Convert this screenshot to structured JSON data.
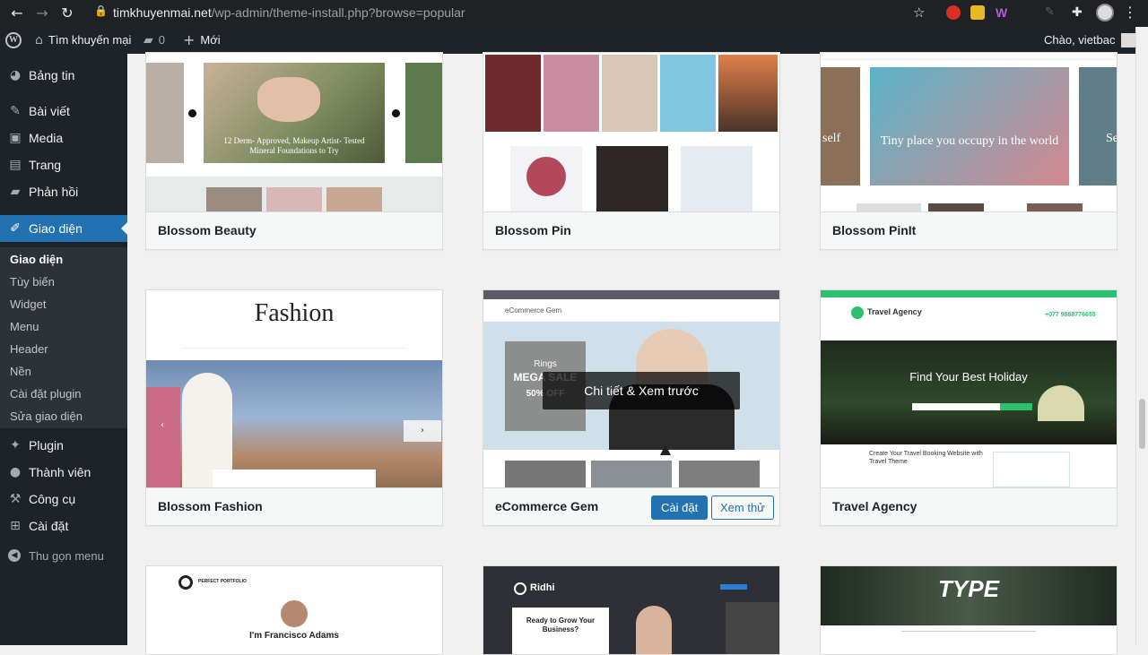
{
  "browser": {
    "url_host": "timkhuyenmai.net",
    "url_path": "/wp-admin/theme-install.php?browse=popular"
  },
  "adminbar": {
    "site_name": "Tìm khuyến mại",
    "comments_count": "0",
    "new_label": "Mới",
    "greeting": "Chào, vietbac"
  },
  "sidebar": {
    "items": [
      {
        "label": "Bảng tin",
        "icon": "dashboard-icon"
      },
      {
        "label": "Bài viết",
        "icon": "pin-icon"
      },
      {
        "label": "Media",
        "icon": "media-icon"
      },
      {
        "label": "Trang",
        "icon": "page-icon"
      },
      {
        "label": "Phản hồi",
        "icon": "comment-icon"
      },
      {
        "label": "Giao diện",
        "icon": "brush-icon"
      },
      {
        "label": "Plugin",
        "icon": "plugin-icon"
      },
      {
        "label": "Thành viên",
        "icon": "users-icon"
      },
      {
        "label": "Công cụ",
        "icon": "tools-icon"
      },
      {
        "label": "Cài đặt",
        "icon": "settings-icon"
      }
    ],
    "submenu": [
      "Giao diện",
      "Tùy biến",
      "Widget",
      "Menu",
      "Header",
      "Nền",
      "Cài đặt plugin",
      "Sửa giao diện"
    ],
    "collapse_label": "Thu gọn menu"
  },
  "themes": {
    "row1": [
      "Blossom Beauty",
      "Blossom Pin",
      "Blossom PinIt"
    ],
    "row2": [
      "Blossom Fashion",
      "eCommerce Gem",
      "Travel Agency"
    ],
    "install_label": "Cài đặt",
    "preview_label": "Xem thử",
    "overlay_label": "Chi tiết & Xem trước"
  },
  "previews": {
    "beauty_caption": "12 Derm- Approved, Makeup Artist- Tested Mineral Foundations to Try",
    "pinit_caption": "Tiny place you occupy in the world",
    "pinit_left": "self",
    "pinit_right": "Se",
    "fashion_title": "Fashion",
    "gem_brand": "eCommerce Gem",
    "gem_rings": "Rings",
    "gem_mega": "MEGA SALE",
    "gem_off": "50% OFF",
    "travel_brand": "Travel Agency",
    "travel_phone": "+077 9888776655",
    "travel_hero": "Find Your Best Holiday",
    "travel_sub": "Create Your Travel Booking Website with Travel Theme",
    "portfolio_name": "I'm Francisco Adams",
    "portfolio_brand": "PERFECT PORTFOLIO",
    "ridhi_brand": "Ridhi",
    "ridhi_cta": "Ready to Grow Your Business?",
    "type_title": "TYPE"
  }
}
